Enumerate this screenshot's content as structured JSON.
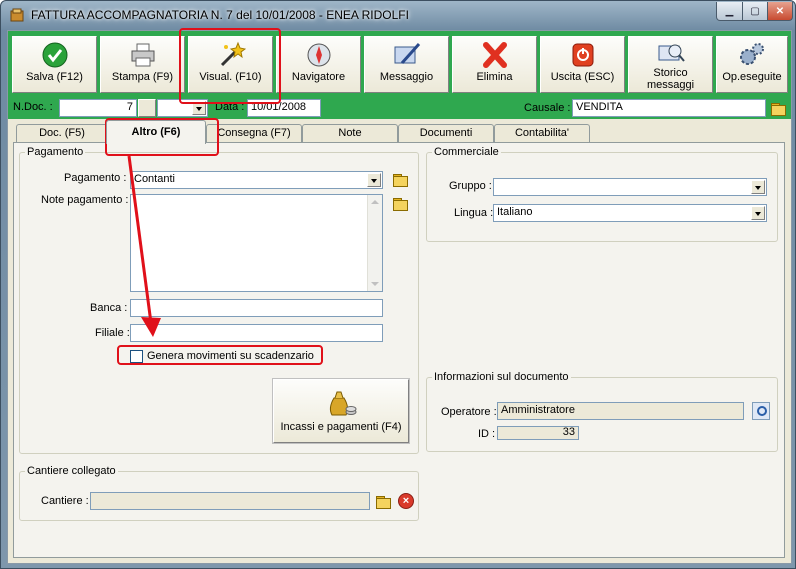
{
  "window": {
    "title": "FATTURA ACCOMPAGNATORIA N. 7  del 10/01/2008 - ENEA RIDOLFI"
  },
  "toolbar": {
    "buttons": [
      {
        "label": "Salva (F12)",
        "icon": "check-icon",
        "color": "#2aa23a"
      },
      {
        "label": "Stampa (F9)",
        "icon": "printer-icon"
      },
      {
        "label": "Visual. (F10)",
        "icon": "magic-wand-icon"
      },
      {
        "label": "Navigatore",
        "icon": "compass-icon"
      },
      {
        "label": "Messaggio",
        "icon": "message-pen-icon"
      },
      {
        "label": "Elimina",
        "icon": "delete-x-icon",
        "color": "#e03020"
      },
      {
        "label": "Uscita (ESC)",
        "icon": "exit-icon",
        "color": "#e04020"
      },
      {
        "label_line1": "Storico",
        "label_line2": "messaggi",
        "icon": "message-history-icon"
      },
      {
        "label": "Op.eseguite",
        "icon": "gears-icon"
      }
    ],
    "background": "#2fa84f"
  },
  "doc": {
    "ndoc_label": "N.Doc. :",
    "ndoc_value": "7",
    "data_label": "Data :",
    "data_value": "10/01/2008",
    "causale_label": "Causale :",
    "causale_value": "VENDITA"
  },
  "tabs": [
    "Doc. (F5)",
    "Altro (F6)",
    "Consegna (F7)",
    "Note",
    "Documenti",
    "Contabilita'"
  ],
  "active_tab": "Altro (F6)",
  "pagamento": {
    "legend": "Pagamento",
    "pagamento_label": "Pagamento :",
    "pagamento_value": "Contanti",
    "note_label": "Note pagamento :",
    "banca_label": "Banca :",
    "filiale_label": "Filiale :",
    "checkbox_label": "Genera movimenti su scadenzario",
    "incassi_button": "Incassi e pagamenti (F4)"
  },
  "commerciale": {
    "legend": "Commerciale",
    "gruppo_label": "Gruppo :",
    "gruppo_value": "",
    "lingua_label": "Lingua :",
    "lingua_value": "Italiano"
  },
  "info": {
    "legend": "Informazioni sul documento",
    "operatore_label": "Operatore :",
    "operatore_value": "Amministratore",
    "id_label": "ID :",
    "id_value": "33"
  },
  "cantiere": {
    "legend": "Cantiere collegato",
    "cantiere_label": "Cantiere :",
    "cantiere_value": ""
  },
  "annotation_color": "#e0101a"
}
